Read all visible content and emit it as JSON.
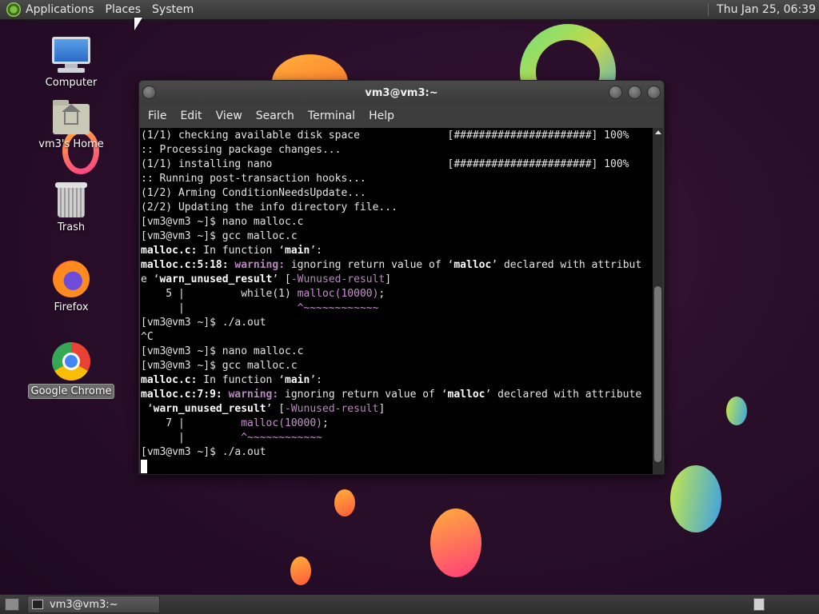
{
  "top_panel": {
    "menus": [
      "Applications",
      "Places",
      "System"
    ],
    "clock": "Thu Jan 25, 06:39"
  },
  "desktop_icons": [
    {
      "label": "Computer",
      "icon": "computer-icon"
    },
    {
      "label": "vm3's Home",
      "icon": "home-folder-icon"
    },
    {
      "label": "Trash",
      "icon": "trash-icon"
    },
    {
      "label": "Firefox",
      "icon": "firefox-icon"
    },
    {
      "label": "Google Chrome",
      "icon": "chrome-icon",
      "selected": true
    }
  ],
  "terminal": {
    "title": "vm3@vm3:~",
    "menu": [
      "File",
      "Edit",
      "View",
      "Search",
      "Terminal",
      "Help"
    ],
    "lines": [
      "(1/1) checking available disk space              [######################] 100%",
      ":: Processing package changes...",
      "(1/1) installing nano                            [######################] 100%",
      ":: Running post-transaction hooks...",
      "(1/2) Arming ConditionNeedsUpdate...",
      "(2/2) Updating the info directory file...",
      "[vm3@vm3 ~]$ nano malloc.c",
      "[vm3@vm3 ~]$ gcc malloc.c",
      "malloc.c: In function ‘main’:",
      "malloc.c:5:18: warning: ignoring return value of ‘malloc’ declared with attribut",
      "e ‘warn_unused_result’ [-Wunused-result]",
      "    5 |         while(1) malloc(10000);",
      "      |                  ^~~~~~~~~~~~~",
      "[vm3@vm3 ~]$ ./a.out",
      "^C",
      "[vm3@vm3 ~]$ nano malloc.c",
      "[vm3@vm3 ~]$ gcc malloc.c",
      "malloc.c: In function ‘main’:",
      "malloc.c:7:9: warning: ignoring return value of ‘malloc’ declared with attribute",
      " ‘warn_unused_result’ [-Wunused-result]",
      "    7 |         malloc(10000);",
      "      |         ^~~~~~~~~~~~~",
      "[vm3@vm3 ~]$ ./a.out"
    ]
  },
  "taskbar": {
    "task_label": "vm3@vm3:~"
  }
}
